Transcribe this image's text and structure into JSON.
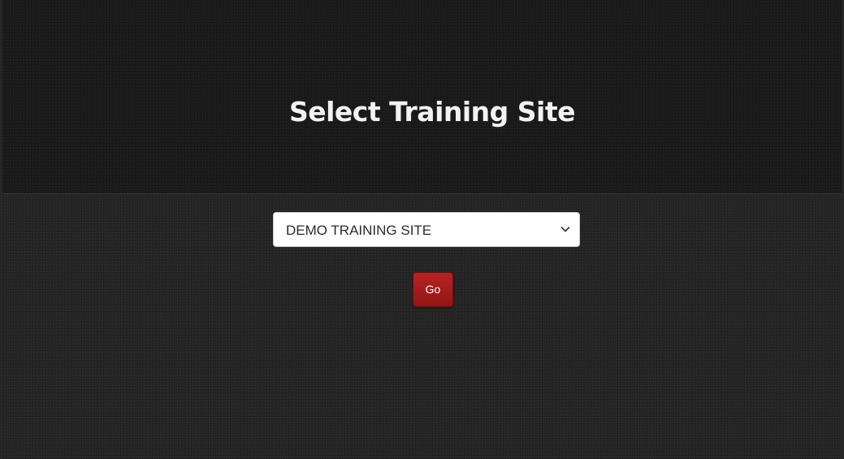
{
  "header": {
    "title": "Select Training Site"
  },
  "form": {
    "site_select": {
      "selected_value": "DEMO TRAINING SITE",
      "icon": "chevron-down-icon"
    },
    "go_label": "Go"
  },
  "colors": {
    "header_background": "#1b1b1b",
    "content_background": "#272727",
    "title_text": "#f2f2f2",
    "go_button": "#a51d1d"
  }
}
